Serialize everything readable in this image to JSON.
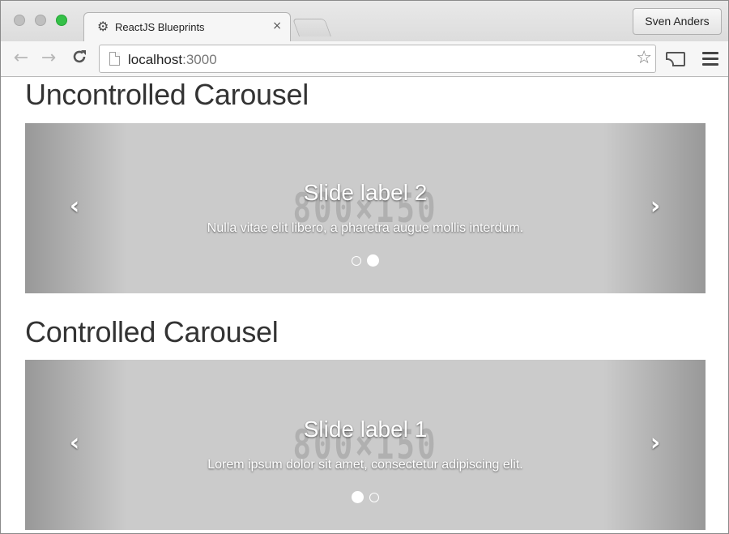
{
  "browser": {
    "tab_title": "ReactJS Blueprints",
    "tab_close": "×",
    "profile_name": "Sven Anders",
    "url_host": "localhost",
    "url_port": ":3000",
    "icons": {
      "back": "←",
      "forward": "→",
      "reload": "C",
      "star": "☆",
      "tab": "⚙"
    }
  },
  "page": {
    "uncontrolled_heading": "Uncontrolled Carousel",
    "controlled_heading": "Controlled Carousel",
    "uncontrolled_carousel": {
      "placeholder_text": "800×150",
      "caption_title": "Slide label 2",
      "caption_text": "Nulla vitae elit libero, a pharetra augue mollis interdum.",
      "prev_icon": "‹",
      "next_icon": "›",
      "active_index": 2,
      "slide_count": 2
    },
    "controlled_carousel": {
      "placeholder_text": "800×150",
      "caption_title": "Slide label 1",
      "caption_text": "Lorem ipsum dolor sit amet, consectetur adipiscing elit.",
      "prev_icon": "‹",
      "next_icon": "›",
      "active_index": 1,
      "slide_count": 2
    }
  }
}
